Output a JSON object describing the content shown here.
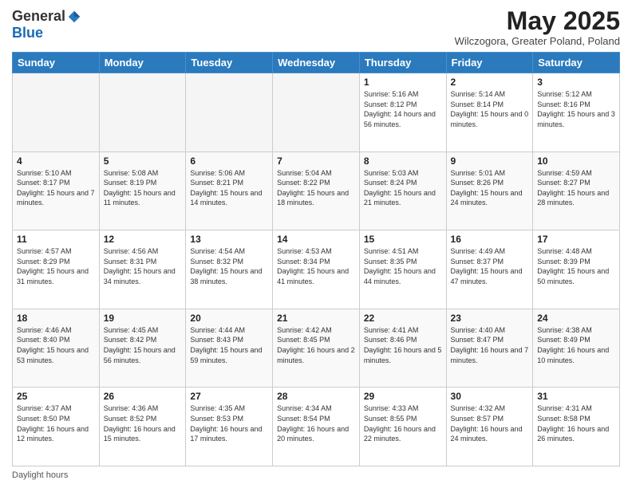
{
  "logo": {
    "general": "General",
    "blue": "Blue"
  },
  "title": "May 2025",
  "subtitle": "Wilczogora, Greater Poland, Poland",
  "days_of_week": [
    "Sunday",
    "Monday",
    "Tuesday",
    "Wednesday",
    "Thursday",
    "Friday",
    "Saturday"
  ],
  "footer_label": "Daylight hours",
  "weeks": [
    [
      {
        "day": "",
        "info": ""
      },
      {
        "day": "",
        "info": ""
      },
      {
        "day": "",
        "info": ""
      },
      {
        "day": "",
        "info": ""
      },
      {
        "day": "1",
        "info": "Sunrise: 5:16 AM\nSunset: 8:12 PM\nDaylight: 14 hours\nand 56 minutes."
      },
      {
        "day": "2",
        "info": "Sunrise: 5:14 AM\nSunset: 8:14 PM\nDaylight: 15 hours\nand 0 minutes."
      },
      {
        "day": "3",
        "info": "Sunrise: 5:12 AM\nSunset: 8:16 PM\nDaylight: 15 hours\nand 3 minutes."
      }
    ],
    [
      {
        "day": "4",
        "info": "Sunrise: 5:10 AM\nSunset: 8:17 PM\nDaylight: 15 hours\nand 7 minutes."
      },
      {
        "day": "5",
        "info": "Sunrise: 5:08 AM\nSunset: 8:19 PM\nDaylight: 15 hours\nand 11 minutes."
      },
      {
        "day": "6",
        "info": "Sunrise: 5:06 AM\nSunset: 8:21 PM\nDaylight: 15 hours\nand 14 minutes."
      },
      {
        "day": "7",
        "info": "Sunrise: 5:04 AM\nSunset: 8:22 PM\nDaylight: 15 hours\nand 18 minutes."
      },
      {
        "day": "8",
        "info": "Sunrise: 5:03 AM\nSunset: 8:24 PM\nDaylight: 15 hours\nand 21 minutes."
      },
      {
        "day": "9",
        "info": "Sunrise: 5:01 AM\nSunset: 8:26 PM\nDaylight: 15 hours\nand 24 minutes."
      },
      {
        "day": "10",
        "info": "Sunrise: 4:59 AM\nSunset: 8:27 PM\nDaylight: 15 hours\nand 28 minutes."
      }
    ],
    [
      {
        "day": "11",
        "info": "Sunrise: 4:57 AM\nSunset: 8:29 PM\nDaylight: 15 hours\nand 31 minutes."
      },
      {
        "day": "12",
        "info": "Sunrise: 4:56 AM\nSunset: 8:31 PM\nDaylight: 15 hours\nand 34 minutes."
      },
      {
        "day": "13",
        "info": "Sunrise: 4:54 AM\nSunset: 8:32 PM\nDaylight: 15 hours\nand 38 minutes."
      },
      {
        "day": "14",
        "info": "Sunrise: 4:53 AM\nSunset: 8:34 PM\nDaylight: 15 hours\nand 41 minutes."
      },
      {
        "day": "15",
        "info": "Sunrise: 4:51 AM\nSunset: 8:35 PM\nDaylight: 15 hours\nand 44 minutes."
      },
      {
        "day": "16",
        "info": "Sunrise: 4:49 AM\nSunset: 8:37 PM\nDaylight: 15 hours\nand 47 minutes."
      },
      {
        "day": "17",
        "info": "Sunrise: 4:48 AM\nSunset: 8:39 PM\nDaylight: 15 hours\nand 50 minutes."
      }
    ],
    [
      {
        "day": "18",
        "info": "Sunrise: 4:46 AM\nSunset: 8:40 PM\nDaylight: 15 hours\nand 53 minutes."
      },
      {
        "day": "19",
        "info": "Sunrise: 4:45 AM\nSunset: 8:42 PM\nDaylight: 15 hours\nand 56 minutes."
      },
      {
        "day": "20",
        "info": "Sunrise: 4:44 AM\nSunset: 8:43 PM\nDaylight: 15 hours\nand 59 minutes."
      },
      {
        "day": "21",
        "info": "Sunrise: 4:42 AM\nSunset: 8:45 PM\nDaylight: 16 hours\nand 2 minutes."
      },
      {
        "day": "22",
        "info": "Sunrise: 4:41 AM\nSunset: 8:46 PM\nDaylight: 16 hours\nand 5 minutes."
      },
      {
        "day": "23",
        "info": "Sunrise: 4:40 AM\nSunset: 8:47 PM\nDaylight: 16 hours\nand 7 minutes."
      },
      {
        "day": "24",
        "info": "Sunrise: 4:38 AM\nSunset: 8:49 PM\nDaylight: 16 hours\nand 10 minutes."
      }
    ],
    [
      {
        "day": "25",
        "info": "Sunrise: 4:37 AM\nSunset: 8:50 PM\nDaylight: 16 hours\nand 12 minutes."
      },
      {
        "day": "26",
        "info": "Sunrise: 4:36 AM\nSunset: 8:52 PM\nDaylight: 16 hours\nand 15 minutes."
      },
      {
        "day": "27",
        "info": "Sunrise: 4:35 AM\nSunset: 8:53 PM\nDaylight: 16 hours\nand 17 minutes."
      },
      {
        "day": "28",
        "info": "Sunrise: 4:34 AM\nSunset: 8:54 PM\nDaylight: 16 hours\nand 20 minutes."
      },
      {
        "day": "29",
        "info": "Sunrise: 4:33 AM\nSunset: 8:55 PM\nDaylight: 16 hours\nand 22 minutes."
      },
      {
        "day": "30",
        "info": "Sunrise: 4:32 AM\nSunset: 8:57 PM\nDaylight: 16 hours\nand 24 minutes."
      },
      {
        "day": "31",
        "info": "Sunrise: 4:31 AM\nSunset: 8:58 PM\nDaylight: 16 hours\nand 26 minutes."
      }
    ]
  ]
}
